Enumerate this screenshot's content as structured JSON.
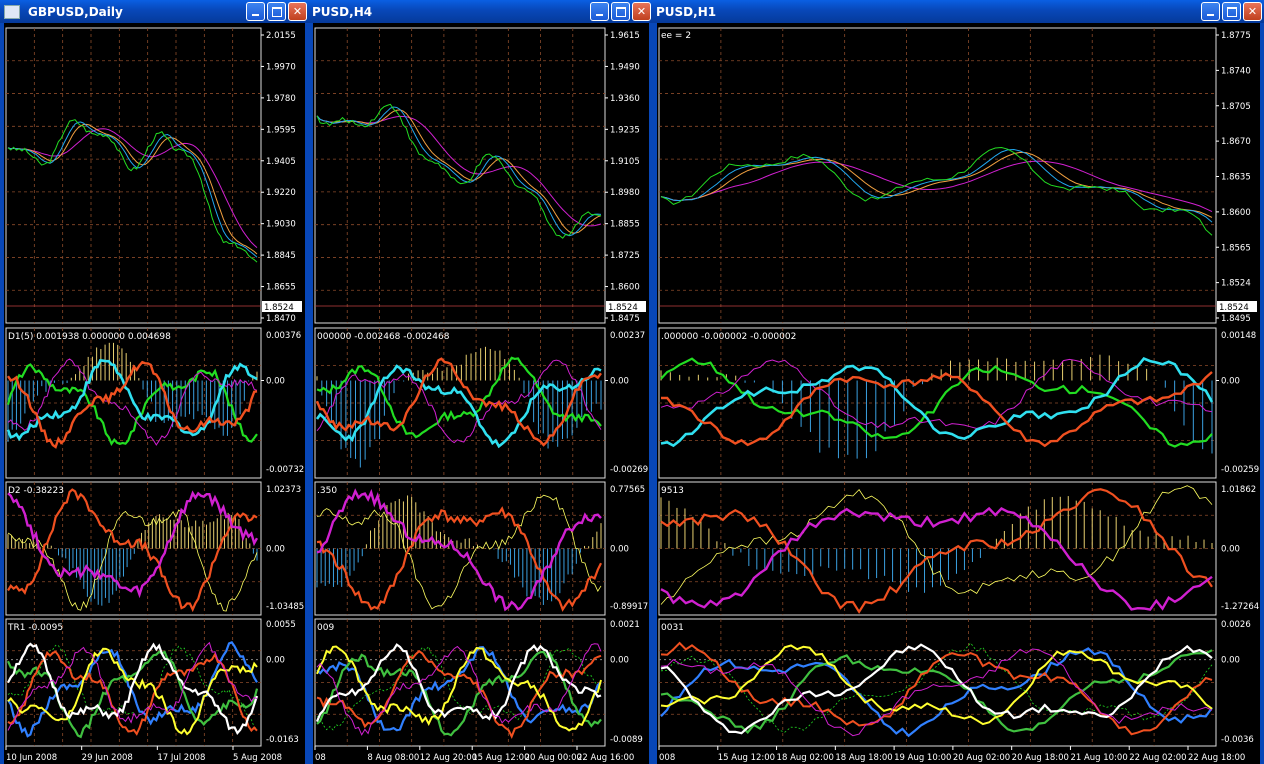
{
  "colors": {
    "titlebar": "#0847b8",
    "grid": "#8a4a2a",
    "price_green": "#22dd22",
    "ma_blue": "#22a8f0",
    "ma_orange": "#f0a040",
    "ma_magenta": "#d020d0",
    "hist_yellow": "#e8d070",
    "hist_blue": "#3aa0e0"
  },
  "icons": {
    "window": "chart-window-icon",
    "minimize": "minimize-icon",
    "maximize": "maximize-icon",
    "close": "close-icon"
  },
  "windows": [
    {
      "title": "GBPUSD,Daily",
      "price_axis": [
        "2.0155",
        "1.9970",
        "1.9780",
        "1.9595",
        "1.9405",
        "1.9220",
        "1.9030",
        "1.8845",
        "1.8655",
        "1.8470"
      ],
      "price_tag": "1.8524",
      "d1_label": "D1(5) 0.001938 0.000000 0.004698",
      "d1_axis": [
        "0.00376",
        "0.00",
        "-0.00732"
      ],
      "d2_label": "D2 -0.38223",
      "d2_axis": [
        "1.02373",
        "0.00",
        "-1.03485"
      ],
      "tr_label": "TR1 -0.0095",
      "tr_axis": [
        "0.0055",
        "0.00",
        "-0.0163"
      ],
      "time_axis": [
        "10 Jun 2008",
        "29 Jun 2008",
        "17 Jul 2008",
        "5 Aug 2008"
      ]
    },
    {
      "title": "PUSD,H4",
      "price_axis": [
        "1.9615",
        "1.9490",
        "1.9360",
        "1.9235",
        "1.9105",
        "1.8980",
        "1.8855",
        "1.8725",
        "1.8600",
        "1.8475"
      ],
      "price_tag": "1.8524",
      "d1_label": "000000 -0.002468 -0.002468",
      "d1_axis": [
        "0.00237",
        "0.00",
        "-0.00269"
      ],
      "d2_label": ".350",
      "d2_axis": [
        "0.77565",
        "0.00",
        "-0.89917"
      ],
      "tr_label": "009",
      "tr_axis": [
        "0.0021",
        "0.00",
        "-0.0089"
      ],
      "time_axis": [
        "08",
        "8 Aug 08:00",
        "12 Aug 20:00",
        "15 Aug 12:00",
        "20 Aug 00:00",
        "22 Aug 16:00"
      ]
    },
    {
      "title": "PUSD,H1",
      "price_label": "ee = 2",
      "price_axis": [
        "1.8775",
        "1.8740",
        "1.8705",
        "1.8670",
        "1.8635",
        "1.8600",
        "1.8565",
        "1.8524",
        "1.8495"
      ],
      "price_tag": "1.8524",
      "d1_label": ".000000 -0.000002 -0.000002",
      "d1_axis": [
        "0.00148",
        "0.00",
        "-0.00259"
      ],
      "d2_label": "9513",
      "d2_axis": [
        "1.01862",
        "0.00",
        "-1.27264"
      ],
      "tr_label": "0031",
      "tr_axis": [
        "0.0026",
        "0.00",
        "-0.0036"
      ],
      "time_axis": [
        "008",
        "15 Aug 12:00",
        "18 Aug 02:00",
        "18 Aug 18:00",
        "19 Aug 10:00",
        "20 Aug 02:00",
        "20 Aug 18:00",
        "21 Aug 10:00",
        "22 Aug 02:00",
        "22 Aug 18:00"
      ]
    }
  ]
}
